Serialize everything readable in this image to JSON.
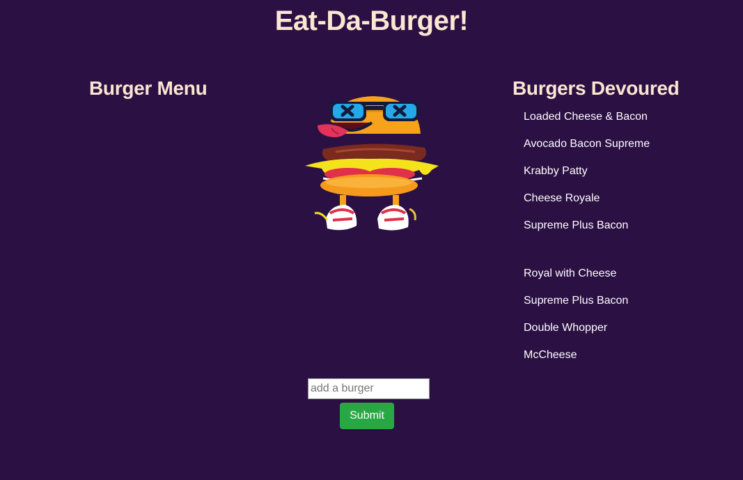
{
  "page": {
    "title": "Eat-Da-Burger!"
  },
  "menu": {
    "title": "Burger Menu",
    "items": []
  },
  "devoured": {
    "title": "Burgers Devoured",
    "items": [
      "Loaded Cheese & Bacon",
      "Avocado Bacon Supreme",
      "Krabby Patty",
      "Cheese Royale",
      "Supreme Plus Bacon",
      "Royal with Cheese",
      "Supreme Plus Bacon",
      "Double Whopper",
      "McCheese"
    ]
  },
  "form": {
    "input_placeholder": "add a burger",
    "input_value": "",
    "submit_label": "Submit"
  },
  "colors": {
    "background": "#2b1044",
    "heading": "#fbe6d2",
    "list_text": "#ffffff",
    "submit_button": "#28a745"
  },
  "icons": {
    "mascot": "burger-mascot-icon"
  }
}
